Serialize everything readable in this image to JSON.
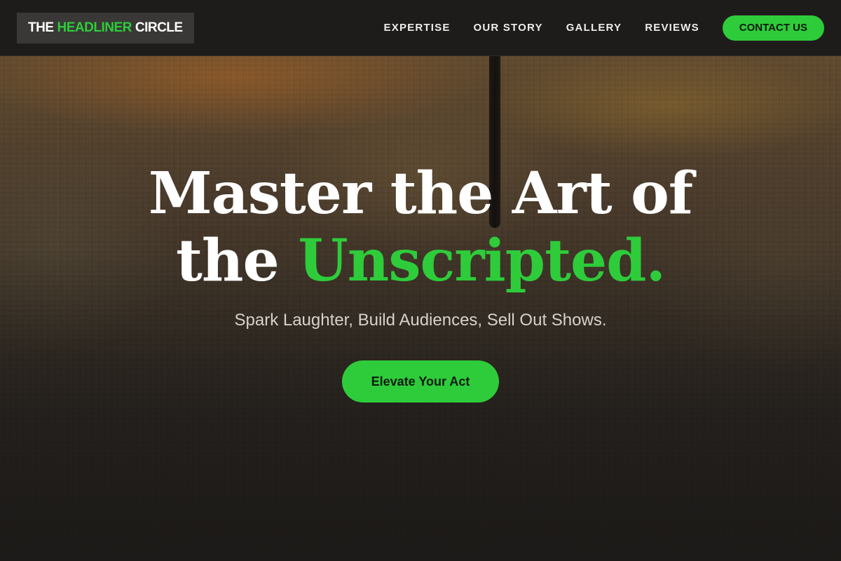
{
  "header": {
    "logo": {
      "part1": "THE",
      "part2": "HEADLINER",
      "part3": "CIRCLE"
    },
    "nav": [
      {
        "label": "EXPERTISE"
      },
      {
        "label": "OUR STORY"
      },
      {
        "label": "GALLERY"
      },
      {
        "label": "REVIEWS"
      }
    ],
    "contact_label": "CONTACT US"
  },
  "hero": {
    "headline_line1": "Master the Art of",
    "headline_line2_plain": "the",
    "headline_line2_accent": "Unscripted.",
    "subtitle": "Spark Laughter, Build Audiences, Sell Out Shows.",
    "cta_label": "Elevate Your Act"
  },
  "colors": {
    "accent": "#2ecc3a",
    "header_bg": "#1e1c1b",
    "logo_bg": "#3a3837"
  }
}
